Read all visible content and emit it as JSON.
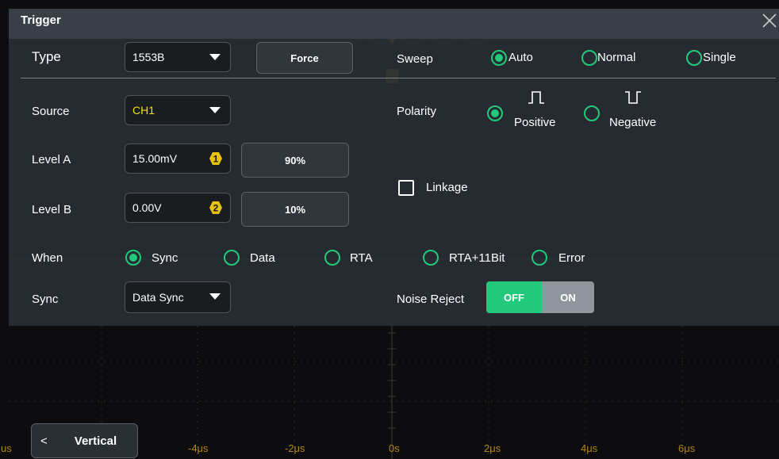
{
  "window": {
    "title": "Trigger"
  },
  "trigger": {
    "type": {
      "label": "Type",
      "value": "1553B"
    },
    "force_label": "Force",
    "sweep": {
      "label": "Sweep",
      "options": [
        "Auto",
        "Normal",
        "Single"
      ],
      "selected": "Auto"
    },
    "source": {
      "label": "Source",
      "value": "CH1"
    },
    "polarity": {
      "label": "Polarity",
      "options": [
        "Positive",
        "Negative"
      ],
      "selected": "Positive"
    },
    "level_a": {
      "label": "Level A",
      "value": "15.00mV",
      "badge": "1",
      "preset": "90%"
    },
    "level_b": {
      "label": "Level B",
      "value": "0.00V",
      "badge": "2",
      "preset": "10%"
    },
    "linkage": {
      "label": "Linkage",
      "checked": false
    },
    "when": {
      "label": "When",
      "options": [
        "Sync",
        "Data",
        "RTA",
        "RTA+11Bit",
        "Error"
      ],
      "selected": "Sync"
    },
    "sync": {
      "label": "Sync",
      "value": "Data Sync"
    },
    "noise_reject": {
      "label": "Noise Reject",
      "off_label": "OFF",
      "on_label": "ON",
      "state": "OFF"
    }
  },
  "scope": {
    "time_ticks": [
      "-4μs",
      "-2μs",
      "0s",
      "2μs",
      "4μs",
      "6μs"
    ],
    "edge_tick": "us"
  },
  "bottom": {
    "vertical_button": "Vertical"
  },
  "colors": {
    "accent": "#22c97a",
    "panel": "#282e34",
    "badge": "#e8c20a",
    "trace": "#d4a017"
  },
  "icons": [
    "close-icon",
    "caret-down-icon",
    "level-a-badge-icon",
    "level-b-badge-icon",
    "positive-pulse-icon",
    "negative-pulse-icon",
    "chevron-left-icon"
  ]
}
